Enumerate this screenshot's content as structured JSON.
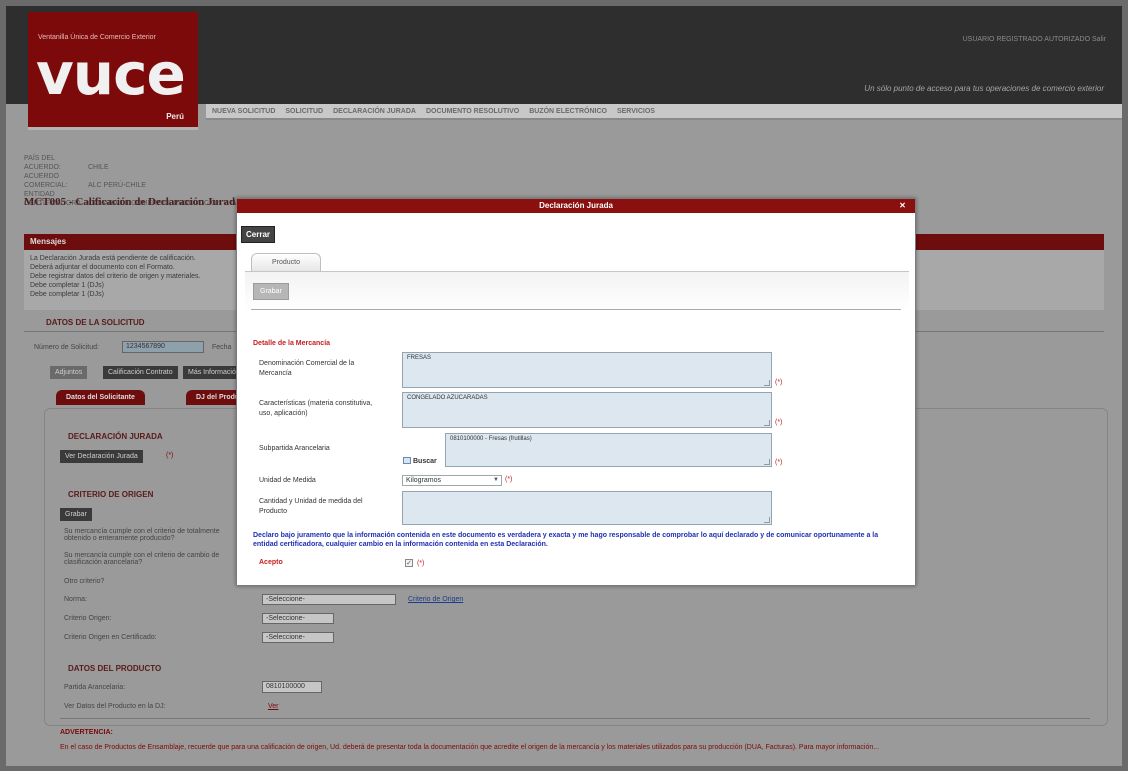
{
  "header": {
    "logo_sub": "Ventanilla Única de Comercio Exterior",
    "logo_text": "vuce",
    "logo_country": "Perú",
    "user_links": "USUARIO REGISTRADO AUTORIZADO   Salir",
    "tagline": "Un sólo punto de acceso para tus operaciones de comercio exterior"
  },
  "menu": [
    "NUEVA SOLICITUD",
    "SOLICITUD",
    "DECLARACIÓN JURADA",
    "DOCUMENTO RESOLUTIVO",
    "BUZÓN ELECTRÓNICO",
    "SERVICIOS"
  ],
  "info": [
    {
      "k": "PAÍS DEL ACUERDO:",
      "v": "CHILE"
    },
    {
      "k": "ACUERDO COMERCIAL:",
      "v": "ALC PERÚ-CHILE"
    },
    {
      "k": "ENTIDAD CERTIFICADORA:",
      "v": "CÁMARA DE COMERCIO, PRODUCCIÓN Y TURISMO DE SAN MARTÍN"
    }
  ],
  "page_title": "MCT005 - Calificación de Declaración Jurada",
  "messages": {
    "title": "Mensajes",
    "lines": [
      "La Declaración Jurada está pendiente de calificación.",
      "Deberá adjuntar el documento con el Formato.",
      "Debe registrar datos del criterio de origen y materiales.",
      "Debe completar 1 (DJs)",
      "Debe completar 1 (DJs)"
    ]
  },
  "solicitud": {
    "section": "DATOS DE LA SOLICITUD",
    "numero_label": "Número de Solicitud:",
    "numero_value": "1234567890",
    "fecha_label": "Fecha",
    "buttons": [
      "Adjuntos",
      "Calificación Contrato",
      "Más Información"
    ],
    "tabs": [
      "Datos del Solicitante",
      "DJ del Producto"
    ]
  },
  "dj_section": {
    "title": "DECLARACIÓN JURADA",
    "button": "Ver Declaración Jurada"
  },
  "criterio": {
    "title": "CRITERIO DE ORIGEN",
    "button": "Grabar",
    "q1": "Su mercancía cumple con el criterio de totalmente obtenido o enteramente producido?",
    "q2": "Su mercancía cumple con el criterio de cambio de clasificación arancelaria?",
    "q3": "Otro criterio?",
    "norma_label": "Norma:",
    "norma_value": "-Seleccione-",
    "norma_link": "Criterio de Origen",
    "criterio_label": "Criterio Origen:",
    "criterio_value": "-Seleccione-",
    "cert_label": "Criterio Origen en Certificado:",
    "cert_value": "-Seleccione-"
  },
  "producto": {
    "title": "DATOS DEL PRODUCTO",
    "partida_label": "Partida Arancelaria:",
    "partida_value": "0810100000",
    "ver_label": "Ver Datos del Producto en la DJ:",
    "ver_link": "Ver"
  },
  "advertencia": {
    "title": "ADVERTENCIA:",
    "text": "En el caso de Productos de Ensamblaje, recuerde que para una calificación de origen, Ud. deberá de presentar toda la documentación que acredite el origen de la mercancía y los materiales utilizados para su producción (DUA, Facturas). Para mayor información..."
  },
  "modal": {
    "title": "Declaración Jurada",
    "close_button": "Cerrar",
    "tab": "Producto",
    "grabar": "Grabar",
    "detalle_title": "Detalle de la Mercancía",
    "fields": {
      "denominacion_label": "Denominación Comercial de la Mercancía",
      "denominacion_value": "FRESAS",
      "caracteristicas_label": "Características (materia constitutiva, uso, aplicación)",
      "caracteristicas_value": "CONGELADO AZUCARADAS",
      "subpartida_label": "Subpartida Arancelaria",
      "subpartida_value": "0810100000 - Fresas (frutillas)",
      "buscar": "Buscar",
      "unidad_label": "Unidad de Medida",
      "unidad_value": "Kilogramos",
      "cantidad_label": "Cantidad y Unidad de medida del Producto",
      "cantidad_value": ""
    },
    "required_mark": "(*)",
    "declaracion": "Declaro bajo juramento que la información contenida en este documento es verdadera y exacta y me hago responsable de comprobar lo aquí declarado y de comunicar oportunamente a la entidad certificadora, cualquier cambio en la información contenida en esta Declaración.",
    "acepto_label": "Acepto",
    "acepto_checked": "✓"
  },
  "colors": {
    "brand_red": "#8a0f0f",
    "overlay_gray": "#9a9a9a",
    "textarea_bg": "#dde7ef",
    "declaration_blue": "#1f2fb3"
  }
}
